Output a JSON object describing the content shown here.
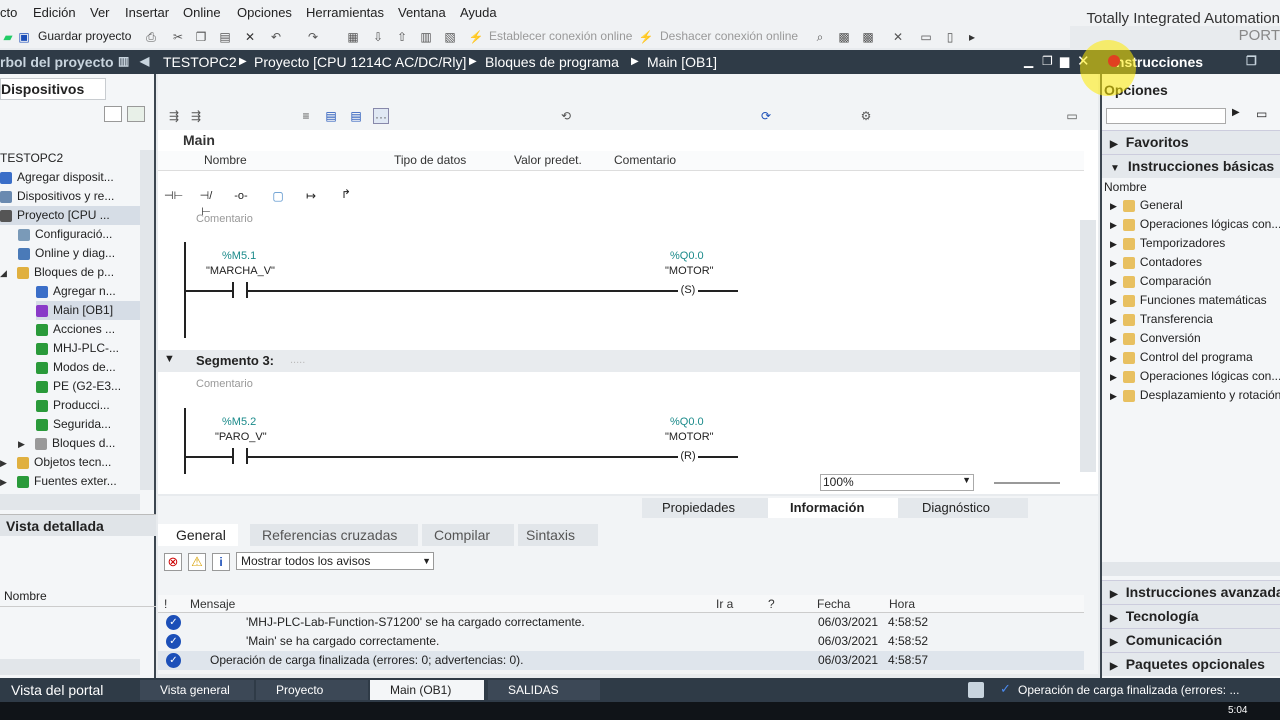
{
  "menu": [
    "cto",
    "Edición",
    "Ver",
    "Insertar",
    "Online",
    "Opciones",
    "Herramientas",
    "Ventana",
    "Ayuda"
  ],
  "toolbar": {
    "save": "Guardar proyecto",
    "connect": "Establecer conexión online",
    "disconnect": "Deshacer conexión online"
  },
  "brand": {
    "line1": "Totally Integrated Automation",
    "line2": "PORT"
  },
  "left": {
    "title": "rbol del proyecto",
    "tab": "Dispositivos",
    "detail": "Vista detallada",
    "col": "Nombre",
    "tree": [
      "TESTOPC2",
      "Agregar disposit...",
      "Dispositivos y re...",
      "Proyecto [CPU ...",
      "Configuració...",
      "Online y diag...",
      "Bloques de p...",
      "Agregar n...",
      "Main [OB1]",
      "Acciones ...",
      "MHJ-PLC-...",
      "Modos de...",
      "PE (G2-E3...",
      "Producci...",
      "Segurida...",
      "Bloques d...",
      "Objetos tecn...",
      "Fuentes exter..."
    ]
  },
  "breadcrumb": [
    "TESTOPC2",
    "Proyecto [CPU 1214C AC/DC/Rly]",
    "Bloques de programa",
    "Main [OB1]"
  ],
  "editor": {
    "block": "Main",
    "cols": [
      "Nombre",
      "Tipo de datos",
      "Valor predet.",
      "Comentario"
    ],
    "comment": "Comentario",
    "seg2": {
      "addr_in": "%M5.1",
      "name_in": "\"MARCHA_V\"",
      "addr_out": "%Q0.0",
      "name_out": "\"MOTOR\"",
      "coil": "S"
    },
    "seg3": {
      "title": "Segmento 3:",
      "dots": ".....",
      "addr_in": "%M5.2",
      "name_in": "\"PARO_V\"",
      "addr_out": "%Q0.0",
      "name_out": "\"MOTOR\"",
      "coil": "R"
    },
    "zoom": "100%"
  },
  "bottom": {
    "tabs_top": [
      "Propiedades",
      "Información",
      "Diagnóstico"
    ],
    "tabs": [
      "General",
      "Referencias cruzadas",
      "Compilar",
      "Sintaxis"
    ],
    "filter": "Mostrar todos los avisos",
    "cols": [
      "!",
      "Mensaje",
      "Ir a",
      "?",
      "Fecha",
      "Hora"
    ],
    "rows": [
      {
        "msg": "'MHJ-PLC-Lab-Function-S71200' se ha cargado correctamente.",
        "date": "06/03/2021",
        "time": "4:58:52"
      },
      {
        "msg": "'Main' se ha cargado correctamente.",
        "date": "06/03/2021",
        "time": "4:58:52"
      },
      {
        "msg": "Operación de carga finalizada (errores: 0; advertencias: 0).",
        "date": "06/03/2021",
        "time": "4:58:57"
      }
    ]
  },
  "right": {
    "title": "Instrucciones",
    "options": "Opciones",
    "favs": "Favoritos",
    "basic": "Instrucciones básicas",
    "col": "Nombre",
    "items": [
      "General",
      "Operaciones lógicas con...",
      "Temporizadores",
      "Contadores",
      "Comparación",
      "Funciones matemáticas",
      "Transferencia",
      "Conversión",
      "Control del programa",
      "Operaciones lógicas con...",
      "Desplazamiento y rotación"
    ],
    "sections": [
      "Instrucciones avanzadas",
      "Tecnología",
      "Comunicación",
      "Paquetes opcionales"
    ]
  },
  "taskbar": {
    "portal": "Vista del portal",
    "tabs": [
      "Vista general",
      "Proyecto",
      "Main (OB1)",
      "SALIDAS"
    ],
    "status": "Operación de carga finalizada (errores: ..."
  },
  "clock": "5:04"
}
